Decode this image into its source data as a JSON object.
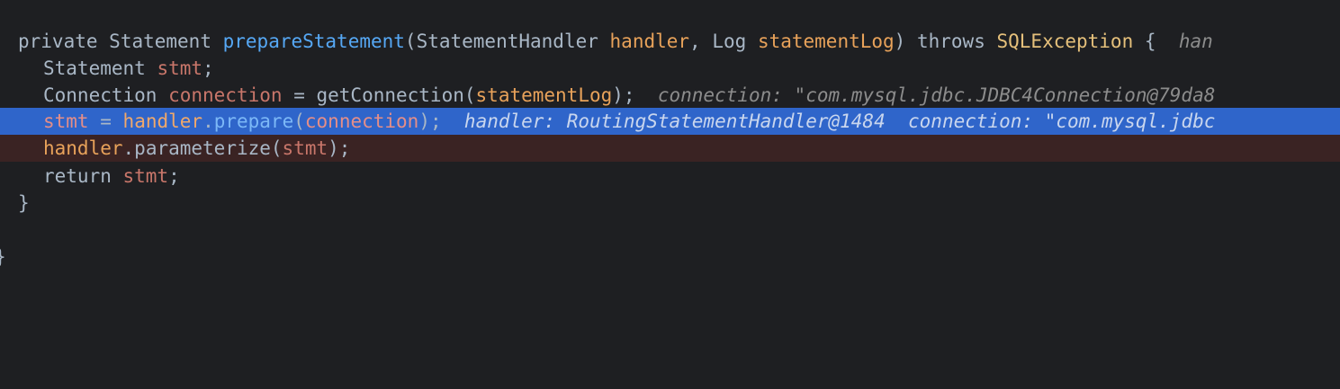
{
  "code": {
    "line1": {
      "kw_private": "private",
      "type_statement": "Statement",
      "method_name": "prepareStatement",
      "open_paren": "(",
      "param1_type": "StatementHandler",
      "param1_name": "handler",
      "comma": ",",
      "param2_type": "Log",
      "param2_name": "statementLog",
      "close_paren": ")",
      "kw_throws": "throws",
      "exception": "SQLException",
      "brace": "{",
      "hint": "han"
    },
    "line2": {
      "type": "Statement",
      "var": "stmt",
      "semi": ";"
    },
    "line3": {
      "type": "Connection",
      "var": "connection",
      "eq": "=",
      "call": "getConnection",
      "open": "(",
      "arg": "statementLog",
      "close": ");",
      "hint": "connection: \"com.mysql.jdbc.JDBC4Connection@79da8"
    },
    "line4": {
      "var": "stmt",
      "eq": "=",
      "obj": "handler",
      "dot": ".",
      "call": "prepare",
      "open": "(",
      "arg": "connection",
      "close": ");",
      "hint1": "handler: RoutingStatementHandler@1484",
      "hint2": "connection: \"com.mysql.jdbc"
    },
    "line5": {
      "obj": "handler",
      "dot": ".",
      "call": "parameterize",
      "open": "(",
      "arg": "stmt",
      "close": ");"
    },
    "line6": {
      "kw_return": "return",
      "var": "stmt",
      "semi": ";"
    },
    "line7": {
      "brace": "}"
    },
    "line8": {
      "brace": "}"
    }
  },
  "colors": {
    "background": "#1e1f22",
    "execution_line": "#2f65ca",
    "breakpoint_line": "#3a2323"
  }
}
